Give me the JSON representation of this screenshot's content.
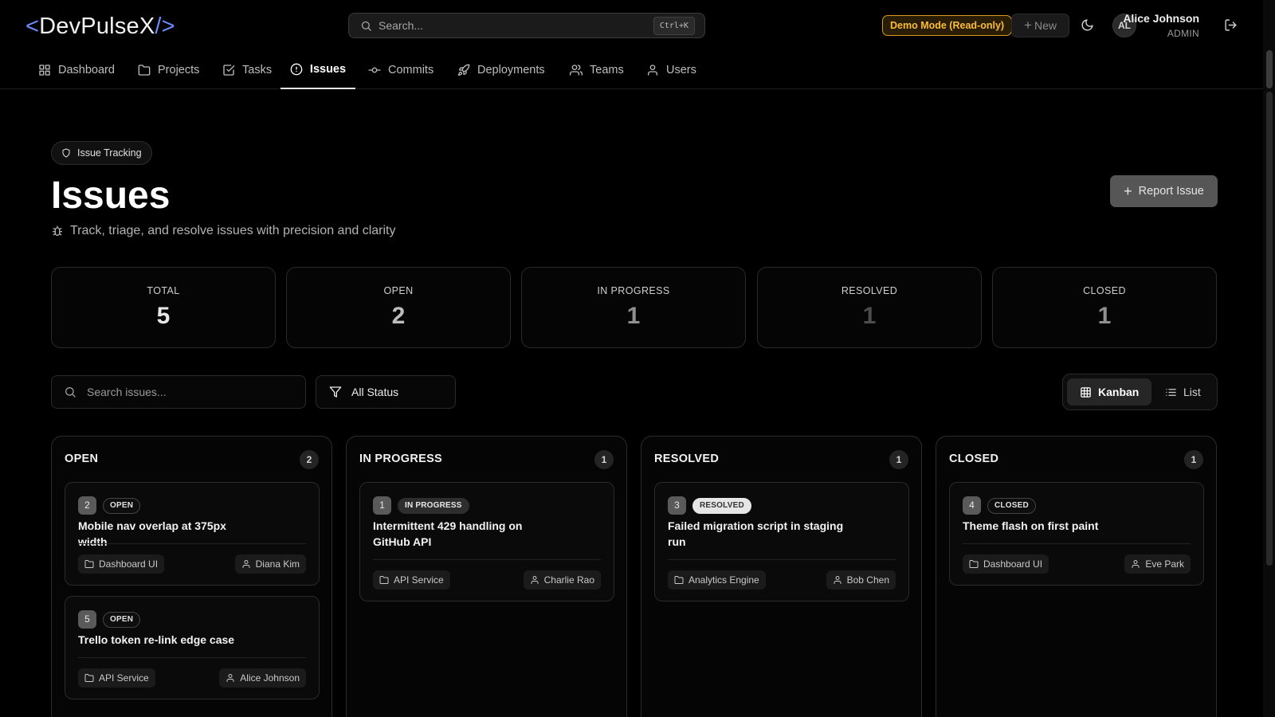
{
  "app": {
    "logo_open": "<",
    "logo_name": "DevPulseX",
    "logo_close": "/>"
  },
  "topbar": {
    "search_placeholder": "Search...",
    "search_shortcut": "Ctrl+K",
    "demo_badge": "Demo Mode (Read-only)",
    "new_label": "New",
    "new_icon": "plus-icon",
    "theme_icon": "moon-icon",
    "user": {
      "initials": "AL",
      "name": "Alice Johnson",
      "role": "ADMIN"
    },
    "logout_icon": "logout-icon"
  },
  "nav": {
    "items": [
      {
        "label": "Dashboard",
        "icon": "grid-icon"
      },
      {
        "label": "Projects",
        "icon": "folder-icon"
      },
      {
        "label": "Tasks",
        "icon": "check-square-icon"
      },
      {
        "label": "Issues",
        "icon": "alert-circle-icon",
        "active": true
      },
      {
        "label": "Commits",
        "icon": "commit-icon"
      },
      {
        "label": "Deployments",
        "icon": "rocket-icon"
      },
      {
        "label": "Teams",
        "icon": "users-icon"
      },
      {
        "label": "Users",
        "icon": "user-icon"
      }
    ]
  },
  "header": {
    "chip": "Issue Tracking",
    "title": "Issues",
    "subtitle": "Track, triage, and resolve issues with precision and clarity",
    "report_button": "Report Issue"
  },
  "stats": [
    {
      "label": "TOTAL",
      "value": "5",
      "color": "#e6e6e6"
    },
    {
      "label": "OPEN",
      "value": "2",
      "color": "#bdbdbd"
    },
    {
      "label": "IN PROGRESS",
      "value": "1",
      "color": "#8f8f8f"
    },
    {
      "label": "RESOLVED",
      "value": "1",
      "color": "#4d4d4d"
    },
    {
      "label": "CLOSED",
      "value": "1",
      "color": "#8f8f8f"
    }
  ],
  "filters": {
    "search_placeholder": "Search issues...",
    "status": "All Status",
    "view_kanban": "Kanban",
    "view_list": "List"
  },
  "columns": [
    {
      "title": "OPEN",
      "count": "2",
      "cards": [
        {
          "num": "2",
          "status": "OPEN",
          "title": "Mobile nav overlap at 375px width",
          "project": "Dashboard UI",
          "assignee": "Diana Kim"
        },
        {
          "num": "5",
          "status": "OPEN",
          "title": "Trello token re-link edge case",
          "project": "API Service",
          "assignee": "Alice Johnson"
        }
      ]
    },
    {
      "title": "IN PROGRESS",
      "count": "1",
      "cards": [
        {
          "num": "1",
          "status": "IN PROGRESS",
          "title": "Intermittent 429 handling on GitHub API",
          "project": "API Service",
          "assignee": "Charlie Rao"
        }
      ]
    },
    {
      "title": "RESOLVED",
      "count": "1",
      "cards": [
        {
          "num": "3",
          "status": "RESOLVED",
          "title": "Failed migration script in staging run",
          "project": "Analytics Engine",
          "assignee": "Bob Chen"
        }
      ]
    },
    {
      "title": "CLOSED",
      "count": "1",
      "cards": [
        {
          "num": "4",
          "status": "CLOSED",
          "title": "Theme flash on first paint",
          "project": "Dashboard UI",
          "assignee": "Eve Park"
        }
      ]
    }
  ]
}
